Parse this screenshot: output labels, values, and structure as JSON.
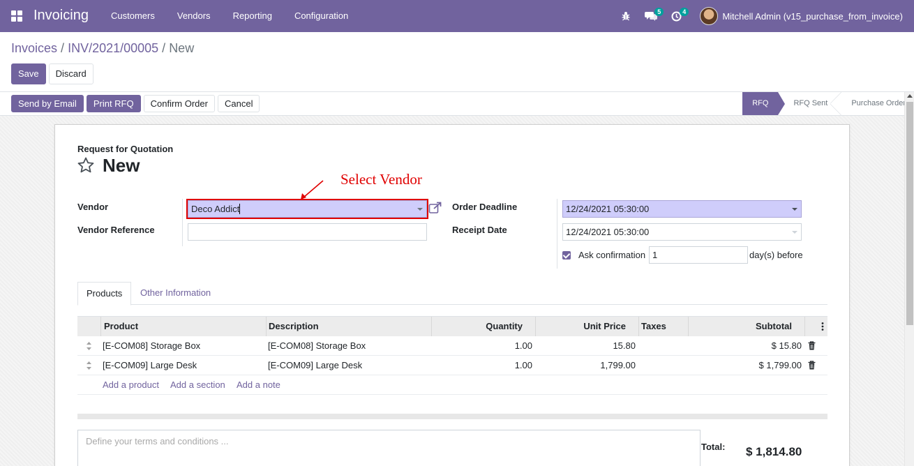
{
  "navbar": {
    "app_title": "Invoicing",
    "menu": [
      "Customers",
      "Vendors",
      "Reporting",
      "Configuration"
    ],
    "messages_badge": "5",
    "activities_badge": "4",
    "user_name": "Mitchell Admin (v15_purchase_from_invoice)"
  },
  "breadcrumb": {
    "items": [
      "Invoices",
      "INV/2021/00005"
    ],
    "current": "New",
    "separator": "/"
  },
  "control": {
    "save_label": "Save",
    "discard_label": "Discard"
  },
  "statusbar": {
    "buttons": [
      "Send by Email",
      "Print RFQ",
      "Confirm Order",
      "Cancel"
    ],
    "stages": [
      "RFQ",
      "RFQ Sent",
      "Purchase Order"
    ],
    "active_stage": "RFQ"
  },
  "form": {
    "doc_type": "Request for Quotation",
    "title": "New",
    "annotation": "Select Vendor",
    "vendor_label": "Vendor",
    "vendor_value": "Deco Addict",
    "vendor_ref_label": "Vendor Reference",
    "vendor_ref_value": "",
    "order_deadline_label": "Order Deadline",
    "order_deadline_value": "12/24/2021 05:30:00",
    "receipt_date_label": "Receipt Date",
    "receipt_date_value": "12/24/2021 05:30:00",
    "ask_confirmation_label": "Ask confirmation",
    "ask_confirmation_checked": true,
    "ask_confirmation_days": "1",
    "days_before_label": "day(s) before"
  },
  "tabs": [
    "Products",
    "Other Information"
  ],
  "lines_table": {
    "columns": [
      "Product",
      "Description",
      "Quantity",
      "Unit Price",
      "Taxes",
      "Subtotal"
    ],
    "rows": [
      {
        "product": "[E-COM08] Storage Box",
        "description": "[E-COM08] Storage Box",
        "quantity": "1.00",
        "unit_price": "15.80",
        "taxes": "",
        "subtotal": "$ 15.80"
      },
      {
        "product": "[E-COM09] Large Desk",
        "description": "[E-COM09] Large Desk",
        "quantity": "1.00",
        "unit_price": "1,799.00",
        "taxes": "",
        "subtotal": "$ 1,799.00"
      }
    ],
    "add_links": [
      "Add a product",
      "Add a section",
      "Add a note"
    ]
  },
  "footer": {
    "terms_placeholder": "Define your terms and conditions ...",
    "total_label": "Total:",
    "total_value": "$ 1,814.80"
  },
  "colors": {
    "brand": "#71639e",
    "highlight": "#cfcdfb",
    "annotation": "#e00000",
    "badge": "#00a09d"
  }
}
